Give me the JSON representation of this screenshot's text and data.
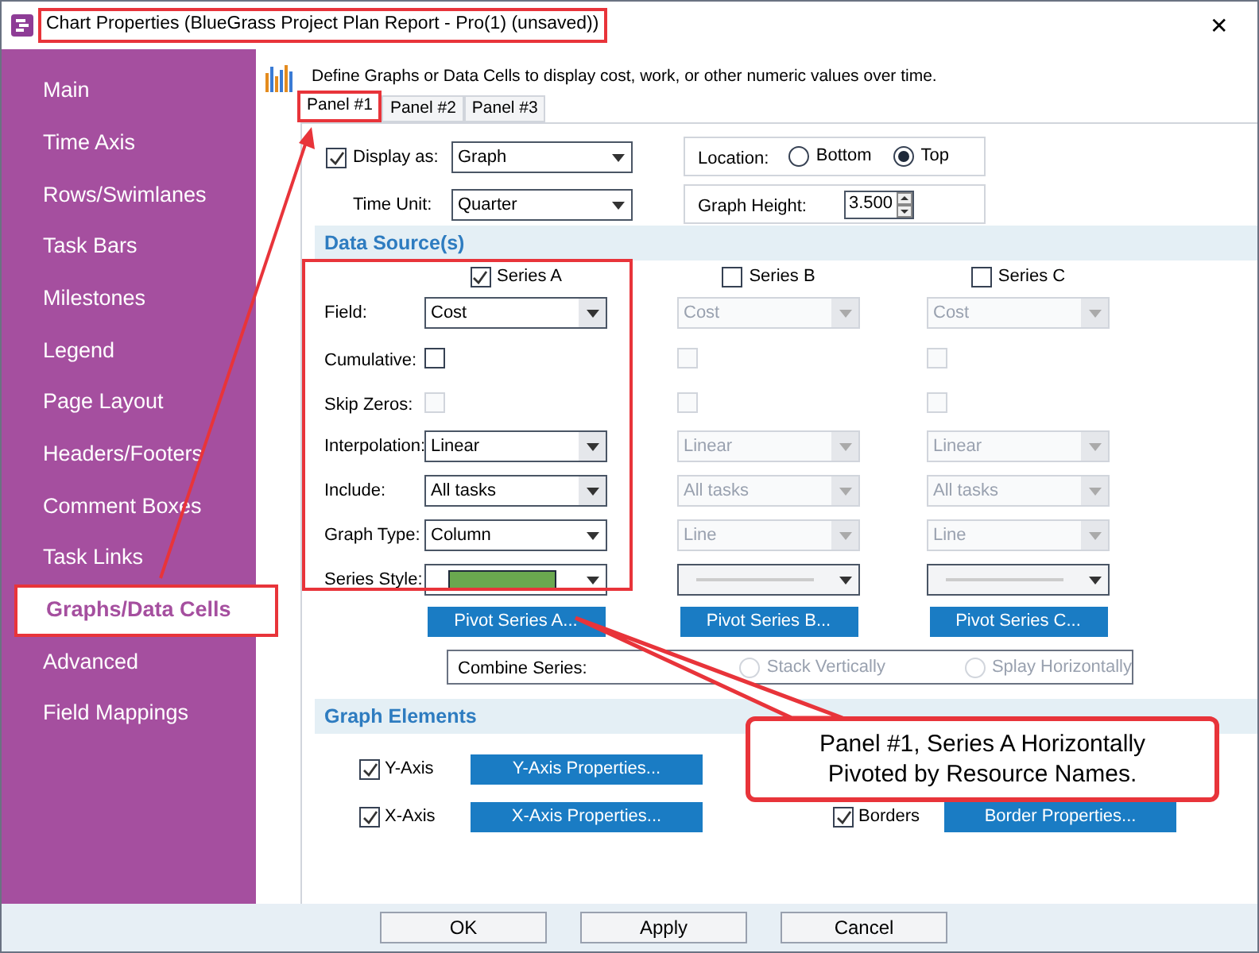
{
  "window": {
    "title": "Chart Properties (BlueGrass Project Plan Report - Pro(1) (unsaved))",
    "close": "✕"
  },
  "sidebar": {
    "items": [
      {
        "label": "Main",
        "selected": false
      },
      {
        "label": "Time Axis",
        "selected": false
      },
      {
        "label": "Rows/Swimlanes",
        "selected": false
      },
      {
        "label": "Task Bars",
        "selected": false
      },
      {
        "label": "Milestones",
        "selected": false
      },
      {
        "label": "Legend",
        "selected": false
      },
      {
        "label": "Page Layout",
        "selected": false
      },
      {
        "label": "Headers/Footers",
        "selected": false
      },
      {
        "label": "Comment Boxes",
        "selected": false
      },
      {
        "label": "Task Links",
        "selected": false
      },
      {
        "label": "Graphs/Data Cells",
        "selected": true
      },
      {
        "label": "Advanced",
        "selected": false
      },
      {
        "label": "Field Mappings",
        "selected": false
      }
    ]
  },
  "description": "Define Graphs or Data Cells to display cost, work, or other numeric values over time.",
  "tabs": [
    {
      "label": "Panel #1",
      "selected": true
    },
    {
      "label": "Panel #2",
      "selected": false
    },
    {
      "label": "Panel #3",
      "selected": false
    }
  ],
  "display_as": {
    "label": "Display as:",
    "checked": true,
    "value": "Graph"
  },
  "time_unit": {
    "label": "Time Unit:",
    "value": "Quarter"
  },
  "location": {
    "label": "Location:",
    "options": [
      {
        "label": "Bottom",
        "selected": false
      },
      {
        "label": "Top",
        "selected": true
      }
    ]
  },
  "graph_height": {
    "label": "Graph Height:",
    "value": "3.500"
  },
  "data_source": {
    "title": "Data Source(s)",
    "row_labels": [
      "Field:",
      "Cumulative:",
      "Skip Zeros:",
      "Interpolation:",
      "Include:",
      "Graph Type:",
      "Series Style:"
    ],
    "series": [
      {
        "label": "Series A",
        "checked": true,
        "disabled": false,
        "field": "Cost",
        "cumulative": false,
        "skip_zeros": false,
        "interpolation": "Linear",
        "include": "All tasks",
        "graph_type": "Column",
        "style": {
          "kind": "swatch",
          "color": "#6aa84f"
        },
        "pivot_button": "Pivot Series A..."
      },
      {
        "label": "Series B",
        "checked": false,
        "disabled": true,
        "field": "Cost",
        "cumulative": false,
        "skip_zeros": false,
        "interpolation": "Linear",
        "include": "All tasks",
        "graph_type": "Line",
        "style": {
          "kind": "line"
        },
        "pivot_button": "Pivot Series B..."
      },
      {
        "label": "Series C",
        "checked": false,
        "disabled": true,
        "field": "Cost",
        "cumulative": false,
        "skip_zeros": false,
        "interpolation": "Linear",
        "include": "All tasks",
        "graph_type": "Line",
        "style": {
          "kind": "line"
        },
        "pivot_button": "Pivot Series C..."
      }
    ]
  },
  "combine": {
    "label": "Combine Series:",
    "options": [
      {
        "label": "Stack Vertically",
        "selected": false,
        "disabled": true
      },
      {
        "label": "Splay Horizontally",
        "selected": false,
        "disabled": true
      }
    ]
  },
  "graph_elements": {
    "title": "Graph Elements",
    "items": [
      {
        "label": "Y-Axis",
        "checked": true,
        "button": "Y-Axis Properties..."
      },
      {
        "label": "X-Axis",
        "checked": true,
        "button": "X-Axis Properties..."
      },
      {
        "label": "Borders",
        "checked": true,
        "button": "Border Properties..."
      }
    ]
  },
  "buttons": [
    "OK",
    "Apply",
    "Cancel"
  ],
  "callout": {
    "text": "Panel #1, Series A Horizontally Pivoted by Resource Names."
  }
}
